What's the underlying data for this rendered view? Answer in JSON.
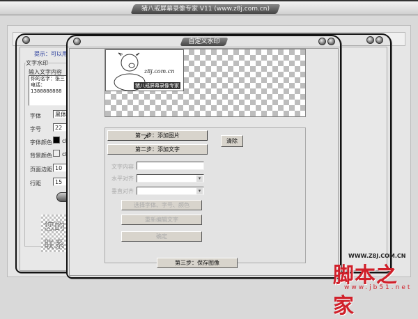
{
  "app": {
    "title": "猪八戒屏幕录像专家 V11 (www.z8j.com.cn)"
  },
  "back_window": {
    "hint": "提示：可以用以",
    "group_title": "文字水印",
    "content_label": "输入文字内容",
    "content_lines": [
      "你的名字：张三",
      "电话：1388888888"
    ],
    "font_label": "字体",
    "font_value": "黑体",
    "size_label": "字号",
    "size_value": "22",
    "font_color_label": "字体颜色",
    "font_color_value": "cl",
    "bg_color_label": "背景颜色",
    "bg_color_value": "cl",
    "margin_label": "页面边距",
    "margin_value": "10",
    "line_label": "行距",
    "line_value": "15",
    "preview_lines": [
      "您的",
      "联系"
    ]
  },
  "dialog": {
    "title": "自定义水印",
    "logo_text": "z8j.com.cn",
    "logo_caption": "猪八戒屏幕录像专家",
    "step1": "第一步：添加图片",
    "step2": "第二步：添加文字",
    "clear": "清除",
    "text_label": "文字内容",
    "text_value": "",
    "halign_label": "水平对齐",
    "halign_value": "",
    "valign_label": "垂直对齐",
    "valign_value": "",
    "choose_font": "选择字体、字号、颜色",
    "reedit": "重新编辑文字",
    "ok": "确定",
    "step3": "第三步：保存图像"
  },
  "watermark": {
    "top": "WWW.Z8J.COM.CN",
    "brand": "脚本之家",
    "url": "www.jb51.net"
  }
}
